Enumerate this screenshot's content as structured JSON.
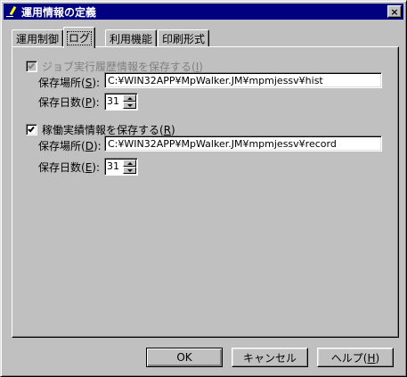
{
  "window": {
    "title": "運用情報の定義",
    "close_glyph": "×"
  },
  "tabs": [
    {
      "label": "運用制御",
      "active": false
    },
    {
      "label": "ログ",
      "active": true
    },
    {
      "label": "利用機能",
      "active": false
    },
    {
      "label": "印刷形式",
      "active": false
    }
  ],
  "job_history": {
    "checkbox_label": "ジョブ実行履歴情報を保存する(",
    "checkbox_accel": "I",
    "checkbox_suffix": ")",
    "checked": true,
    "disabled": true,
    "location_label": "保存場所(",
    "location_accel": "S",
    "location_suffix": "):",
    "location_value": "C:¥WIN32APP¥MpWalker.JM¥mpmjessv¥hist",
    "days_label": "保存日数(",
    "days_accel": "P",
    "days_suffix": "):",
    "days_value": "31"
  },
  "operation_record": {
    "checkbox_label": "稼働実績情報を保存する(",
    "checkbox_accel": "R",
    "checkbox_suffix": ")",
    "checked": true,
    "disabled": false,
    "location_label": "保存場所(",
    "location_accel": "D",
    "location_suffix": "):",
    "location_value": "C:¥WIN32APP¥MpWalker.JM¥mpmjessv¥record",
    "days_label": "保存日数(",
    "days_accel": "E",
    "days_suffix": "):",
    "days_value": "31"
  },
  "buttons": {
    "ok": "OK",
    "cancel": "キャンセル",
    "help_label": "ヘルプ(",
    "help_accel": "H",
    "help_suffix": ")"
  }
}
